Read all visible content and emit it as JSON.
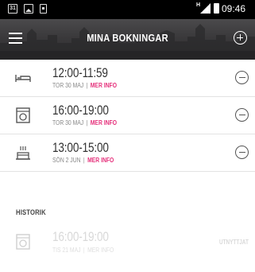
{
  "status_bar": {
    "calendar_day": "31",
    "network": "H",
    "time": "09:46"
  },
  "toolbar": {
    "title": "MINA BOKNINGAR",
    "menu_icon": "hamburger-menu-icon",
    "add_icon": "add-circle-icon"
  },
  "bookings": [
    {
      "icon": "bed-icon",
      "time": "12:00-11:59",
      "date": "TOR 30 MAJ",
      "more": "MER INFO"
    },
    {
      "icon": "washing-machine-icon",
      "time": "16:00-19:00",
      "date": "TOR 30 MAJ",
      "more": "MER INFO"
    },
    {
      "icon": "cake-icon",
      "time": "13:00-15:00",
      "date": "SÖN 2 JUN",
      "more": "MER INFO"
    }
  ],
  "history": {
    "title": "HISTORIK",
    "items": [
      {
        "icon": "washing-machine-icon",
        "time": "16:00-19:00",
        "date": "TIS 21 MAJ",
        "more": "MER INFO",
        "status": "UTNYTTJAT"
      }
    ]
  },
  "colors": {
    "accent": "#e52f7a",
    "toolbar": "#3a393b"
  }
}
